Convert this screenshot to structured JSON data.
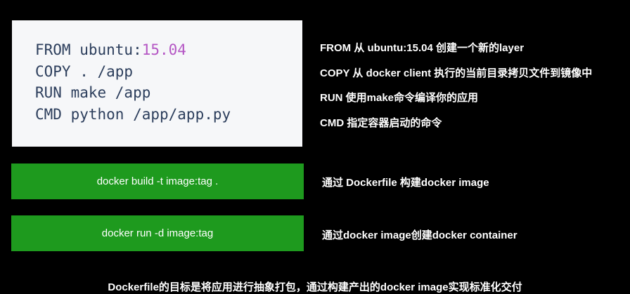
{
  "code": {
    "lines": [
      {
        "text": "FROM ubuntu:",
        "num": "15.04"
      },
      {
        "text": "COPY . /app",
        "num": ""
      },
      {
        "text": "RUN make /app",
        "num": ""
      },
      {
        "text": "CMD python /app/app.py",
        "num": ""
      }
    ]
  },
  "descriptions": [
    "FROM 从 ubuntu:15.04 创建一个新的layer",
    "COPY 从 docker client 执行的当前目录拷贝文件到镜像中",
    "RUN   使用make命令编译你的应用",
    "CMD  指定容器启动的命令"
  ],
  "commands": [
    {
      "label": "docker build -t image:tag .",
      "desc": "通过 Dockerfile 构建docker image"
    },
    {
      "label": "docker run -d image:tag",
      "desc": "通过docker image创建docker container"
    }
  ],
  "footer": "Dockerfile的目标是将应用进行抽象打包，通过构建产出的docker image实现标准化交付",
  "colors": {
    "background": "#000000",
    "code_bg": "#f6f7f9",
    "code_text": "#2c3e5c",
    "code_number": "#b456c4",
    "green": "#1e9a1e"
  }
}
